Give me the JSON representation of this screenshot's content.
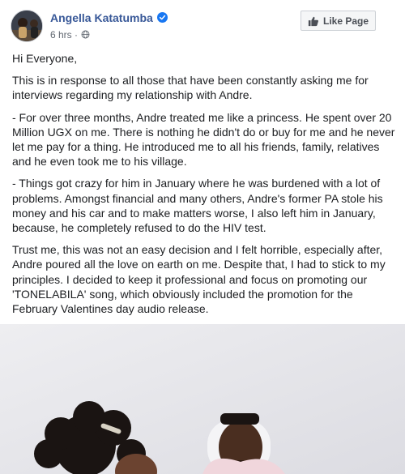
{
  "header": {
    "author_name": "Angella Katatumba",
    "timestamp": "6 hrs",
    "separator": "·",
    "like_page_label": "Like Page",
    "verified_color": "#1877f2",
    "link_color": "#385898"
  },
  "icons": {
    "verified": "verified-badge-icon",
    "privacy": "globe-icon",
    "like": "thumbs-up-icon"
  },
  "post": {
    "paragraphs": [
      "Hi Everyone,",
      "This is in response to all those that have been constantly asking me for interviews regarding my relationship with Andre.",
      "- For over three months, Andre treated me like a princess. He spent over 20 Million UGX on me. There is nothing he didn't do or buy for me and he never let me pay for a thing. He introduced me to all his friends, family, relatives and he even took me to his village.",
      "- Things got crazy for him in January where he was burdened with a lot of problems. Amongst financial and many others, Andre's former PA stole his money and his car and to make matters worse, I also left him in January, because, he completely refused to do the HIV test.",
      "Trust me, this was not an easy decision and I felt horrible, especially after, Andre poured all the love on earth on me. Despite that, I had to stick to my principles. I decided to keep it professional and focus on promoting our 'TONELABILA' song, which obviously included the promotion for the February Valentines day audio release."
    ]
  }
}
